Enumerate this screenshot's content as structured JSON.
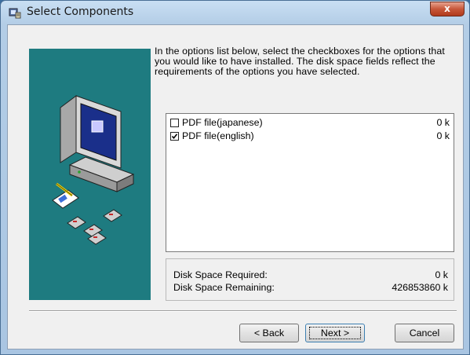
{
  "window": {
    "title": "Select Components",
    "close_label": "x"
  },
  "instructions": "In the options list below, select the checkboxes for the options that you would like to have installed. The disk space fields reflect the requirements of the options you have selected.",
  "components": [
    {
      "label": "PDF file(japanese)",
      "size": "0 k",
      "checked": false
    },
    {
      "label": "PDF file(english)",
      "size": "0 k",
      "checked": true
    }
  ],
  "disk_space": {
    "required_label": "Disk Space Required:",
    "required_value": "0 k",
    "remaining_label": "Disk Space Remaining:",
    "remaining_value": "426853860 k"
  },
  "buttons": {
    "back": "< Back",
    "next": "Next >",
    "cancel": "Cancel"
  },
  "colors": {
    "side_panel": "#1e7b80",
    "close_button": "#c7573a"
  },
  "icons": [
    "app-installer-icon",
    "computer-illustration",
    "floppy-disk-icon",
    "document-icon"
  ]
}
